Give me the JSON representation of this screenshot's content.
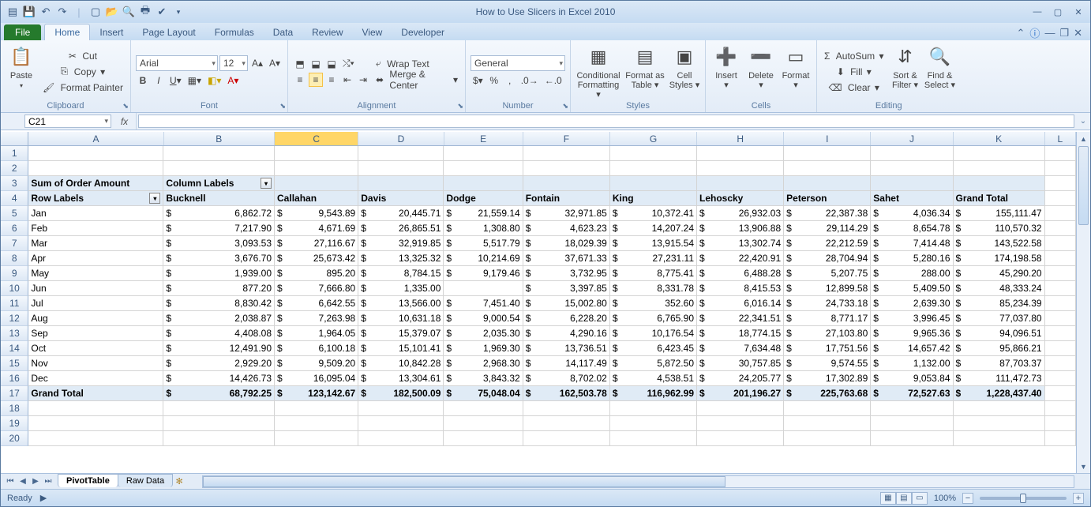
{
  "app": {
    "title": "How to Use Slicers in Excel 2010"
  },
  "qat": [
    "excel",
    "save",
    "undo",
    "redo",
    "|",
    "new",
    "open",
    "print-preview",
    "quick-print",
    "spelling"
  ],
  "tabs": {
    "file": "File",
    "list": [
      "Home",
      "Insert",
      "Page Layout",
      "Formulas",
      "Data",
      "Review",
      "View",
      "Developer"
    ],
    "active": "Home"
  },
  "ribbon": {
    "clipboard": {
      "label": "Clipboard",
      "paste": "Paste",
      "cut": "Cut",
      "copy": "Copy",
      "painter": "Format Painter"
    },
    "font": {
      "label": "Font",
      "name": "Arial",
      "size": "12"
    },
    "alignment": {
      "label": "Alignment",
      "wrap": "Wrap Text",
      "merge": "Merge & Center"
    },
    "number": {
      "label": "Number",
      "format": "General"
    },
    "styles": {
      "label": "Styles",
      "cf": "Conditional Formatting",
      "fat": "Format as Table",
      "cs": "Cell Styles"
    },
    "cells": {
      "label": "Cells",
      "insert": "Insert",
      "delete": "Delete",
      "format": "Format"
    },
    "editing": {
      "label": "Editing",
      "autosum": "AutoSum",
      "fill": "Fill",
      "clear": "Clear",
      "sort": "Sort & Filter",
      "find": "Find & Select"
    }
  },
  "namebox": "C21",
  "columns": [
    "A",
    "B",
    "C",
    "D",
    "E",
    "F",
    "G",
    "H",
    "I",
    "J",
    "K",
    "L"
  ],
  "selected_col": "C",
  "pivot": {
    "value_field": "Sum of Order Amount",
    "column_labels": "Column Labels",
    "row_labels": "Row Labels",
    "cols": [
      "Bucknell",
      "Callahan",
      "Davis",
      "Dodge",
      "Fontain",
      "King",
      "Lehoscky",
      "Peterson",
      "Sahet",
      "Grand Total"
    ],
    "rows": [
      {
        "l": "Jan",
        "v": [
          "6,862.72",
          "9,543.89",
          "20,445.71",
          "21,559.14",
          "32,971.85",
          "10,372.41",
          "26,932.03",
          "22,387.38",
          "4,036.34",
          "155,111.47"
        ]
      },
      {
        "l": "Feb",
        "v": [
          "7,217.90",
          "4,671.69",
          "26,865.51",
          "1,308.80",
          "4,623.23",
          "14,207.24",
          "13,906.88",
          "29,114.29",
          "8,654.78",
          "110,570.32"
        ]
      },
      {
        "l": "Mar",
        "v": [
          "3,093.53",
          "27,116.67",
          "32,919.85",
          "5,517.79",
          "18,029.39",
          "13,915.54",
          "13,302.74",
          "22,212.59",
          "7,414.48",
          "143,522.58"
        ]
      },
      {
        "l": "Apr",
        "v": [
          "3,676.70",
          "25,673.42",
          "13,325.32",
          "10,214.69",
          "37,671.33",
          "27,231.11",
          "22,420.91",
          "28,704.94",
          "5,280.16",
          "174,198.58"
        ]
      },
      {
        "l": "May",
        "v": [
          "1,939.00",
          "895.20",
          "8,784.15",
          "9,179.46",
          "3,732.95",
          "8,775.41",
          "6,488.28",
          "5,207.75",
          "288.00",
          "45,290.20"
        ]
      },
      {
        "l": "Jun",
        "v": [
          "877.20",
          "7,666.80",
          "1,335.00",
          "",
          "3,397.85",
          "8,331.78",
          "8,415.53",
          "12,899.58",
          "5,409.50",
          "48,333.24"
        ]
      },
      {
        "l": "Jul",
        "v": [
          "8,830.42",
          "6,642.55",
          "13,566.00",
          "7,451.40",
          "15,002.80",
          "352.60",
          "6,016.14",
          "24,733.18",
          "2,639.30",
          "85,234.39"
        ]
      },
      {
        "l": "Aug",
        "v": [
          "2,038.87",
          "7,263.98",
          "10,631.18",
          "9,000.54",
          "6,228.20",
          "6,765.90",
          "22,341.51",
          "8,771.17",
          "3,996.45",
          "77,037.80"
        ]
      },
      {
        "l": "Sep",
        "v": [
          "4,408.08",
          "1,964.05",
          "15,379.07",
          "2,035.30",
          "4,290.16",
          "10,176.54",
          "18,774.15",
          "27,103.80",
          "9,965.36",
          "94,096.51"
        ]
      },
      {
        "l": "Oct",
        "v": [
          "12,491.90",
          "6,100.18",
          "15,101.41",
          "1,969.30",
          "13,736.51",
          "6,423.45",
          "7,634.48",
          "17,751.56",
          "14,657.42",
          "95,866.21"
        ]
      },
      {
        "l": "Nov",
        "v": [
          "2,929.20",
          "9,509.20",
          "10,842.28",
          "2,968.30",
          "14,117.49",
          "5,872.50",
          "30,757.85",
          "9,574.55",
          "1,132.00",
          "87,703.37"
        ]
      },
      {
        "l": "Dec",
        "v": [
          "14,426.73",
          "16,095.04",
          "13,304.61",
          "3,843.32",
          "8,702.02",
          "4,538.51",
          "24,205.77",
          "17,302.89",
          "9,053.84",
          "111,472.73"
        ]
      }
    ],
    "grand": {
      "l": "Grand Total",
      "v": [
        "68,792.25",
        "123,142.67",
        "182,500.09",
        "75,048.04",
        "162,503.78",
        "116,962.99",
        "201,196.27",
        "225,763.68",
        "72,527.63",
        "1,228,437.40"
      ]
    }
  },
  "sheets": {
    "active": "PivotTable",
    "list": [
      "PivotTable",
      "Raw Data"
    ]
  },
  "status": {
    "ready": "Ready",
    "zoom": "100%"
  }
}
